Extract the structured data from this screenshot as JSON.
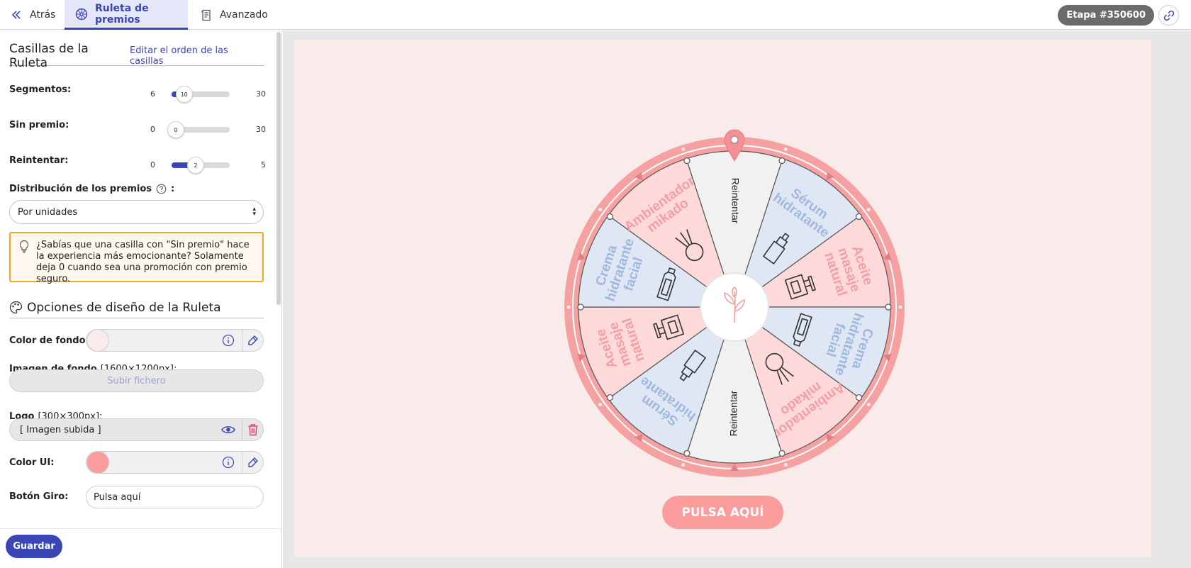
{
  "topbar": {
    "back_label": "Atrás",
    "ruleta_tab_label": "Ruleta de premios",
    "avanzado_tab_label": "Avanzado",
    "etapa_label": "Etapa #350600"
  },
  "sidebar": {
    "casillas_title": "Casillas de la Ruleta",
    "edit_order_link": "Editar el orden de las casillas",
    "segmentos": {
      "label": "Segmentos:",
      "min": "6",
      "max": "30",
      "value": "10",
      "min_n": 6,
      "max_n": 30,
      "value_n": 10
    },
    "sin_premio": {
      "label": "Sin premio:",
      "min": "0",
      "max": "30",
      "value": "0",
      "min_n": 0,
      "max_n": 30,
      "value_n": 0
    },
    "reintentar": {
      "label": "Reintentar:",
      "min": "0",
      "max": "5",
      "value": "2",
      "min_n": 0,
      "max_n": 5,
      "value_n": 2
    },
    "distribucion_label": "Distribución de los premios",
    "distribucion_suffix": ":",
    "distribucion_value": "Por unidades",
    "tip_text": "¿Sabías que una casilla con \"Sin premio\" hace la experiencia más emocionante? Solamente deja 0 cuando sea una promoción con premio seguro.",
    "diseno_title": "Opciones de diseño de la Ruleta",
    "color_fondo_label": "Color de fondo:",
    "color_fondo_value": "#f8ebe9",
    "imagen_fondo_label": "Imagen de fondo",
    "imagen_fondo_size": "[1600×1200px]:",
    "upload_label": "Subir fichero",
    "logo_label": "Logo",
    "logo_size": "[300×300px]:",
    "logo_value": "[ Imagen subida ]",
    "color_ui_label": "Color UI:",
    "color_ui_value": "#fa9c9c",
    "boton_giro_label": "Botón Giro:",
    "boton_giro_value": "Pulsa aquí",
    "save_label": "Guardar"
  },
  "wheel": {
    "segments": [
      {
        "label": "Reintentar",
        "kind": "retry",
        "color": "#f1f1f1",
        "text_color": "#222222",
        "icon": ""
      },
      {
        "label": "Sérum hidratante",
        "kind": "prize",
        "color": "#dfe7f4",
        "text_color": "#9fb8dd",
        "icon": "serum-bottle-icon"
      },
      {
        "label": "Aceite masaje natural",
        "kind": "prize",
        "color": "#fdd9d9",
        "text_color": "#f2a0a2",
        "icon": "pump-bottle-icon"
      },
      {
        "label": "Crema hidratante facial",
        "kind": "prize",
        "color": "#dfe7f4",
        "text_color": "#9fb8dd",
        "icon": "cream-tube-icon"
      },
      {
        "label": "Ambientador mikado",
        "kind": "prize",
        "color": "#fdd9d9",
        "text_color": "#f2a0a2",
        "icon": "diffuser-icon"
      },
      {
        "label": "Reintentar",
        "kind": "retry",
        "color": "#f1f1f1",
        "text_color": "#222222",
        "icon": ""
      },
      {
        "label": "Sérum hidratante",
        "kind": "prize",
        "color": "#dfe7f4",
        "text_color": "#9fb8dd",
        "icon": "serum-bottle-icon"
      },
      {
        "label": "Aceite masaje natural",
        "kind": "prize",
        "color": "#fdd9d9",
        "text_color": "#f2a0a2",
        "icon": "pump-bottle-icon"
      },
      {
        "label": "Crema hidratante facial",
        "kind": "prize",
        "color": "#dfe7f4",
        "text_color": "#9fb8dd",
        "icon": "cream-tube-icon"
      },
      {
        "label": "Ambientador mikado",
        "kind": "prize",
        "color": "#fdd9d9",
        "text_color": "#f2a0a2",
        "icon": "diffuser-icon"
      }
    ],
    "ring_color": "#f6a1a1",
    "center_icon": "leaf-sprig-icon",
    "pointer_icon": "map-pin-icon",
    "spin_button_label": "PULSA AQUÍ"
  },
  "colors": {
    "accent": "#3b46b5",
    "warning_border": "#f6a623",
    "canvas_bg": "#f8ebe9",
    "ui_pink": "#fa9c9c"
  }
}
